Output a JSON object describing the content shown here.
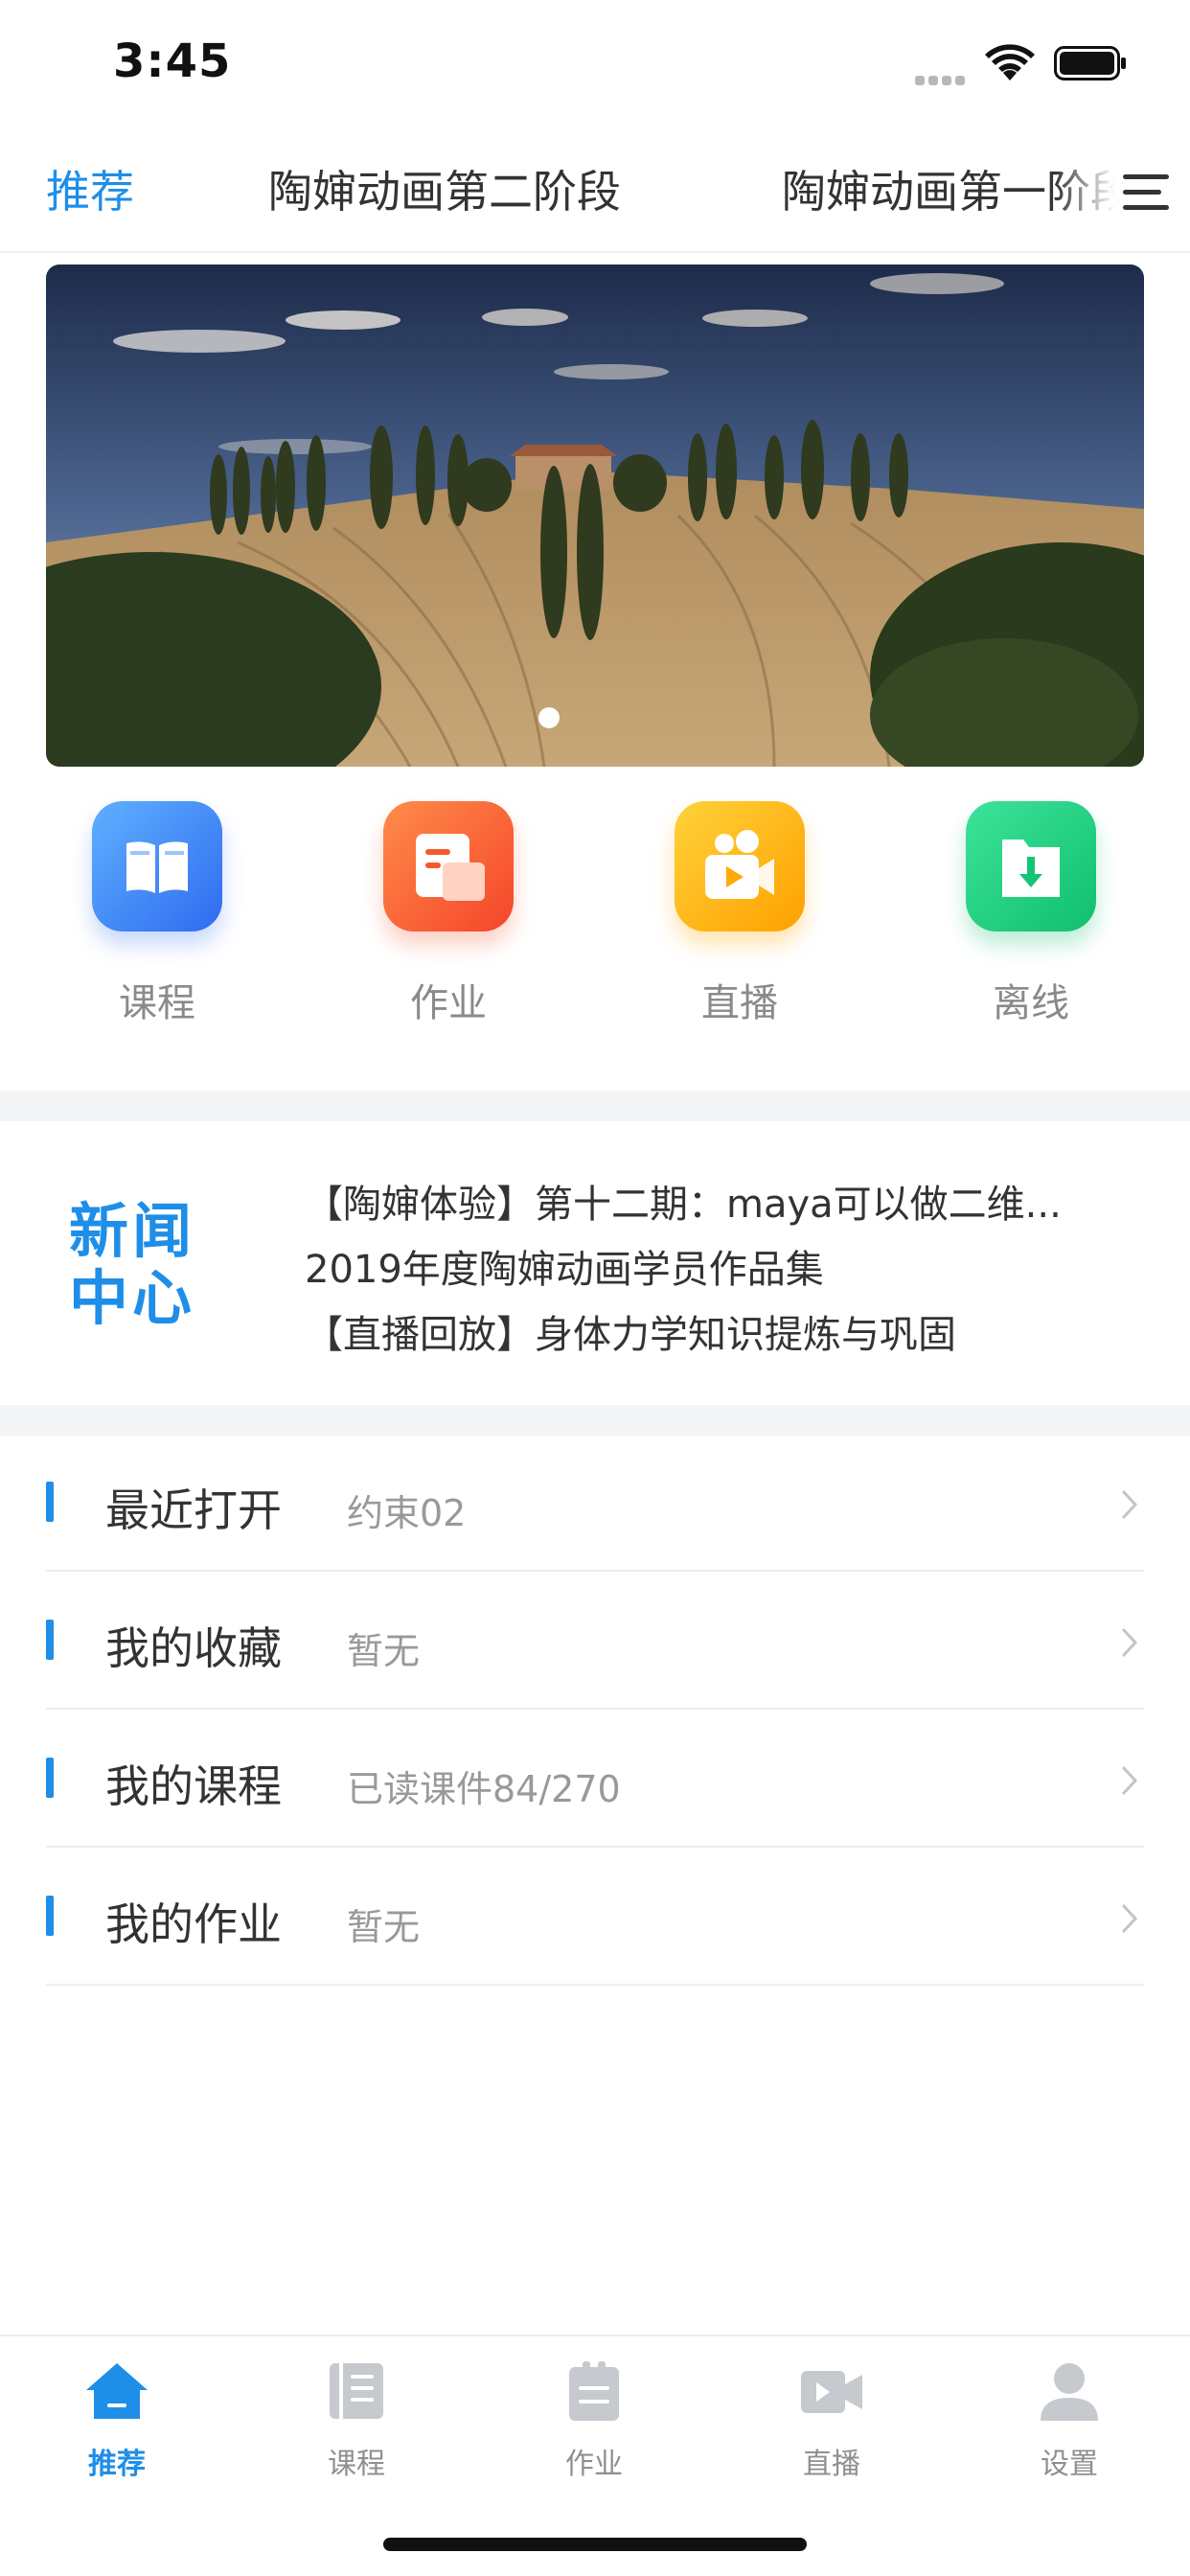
{
  "status_bar": {
    "time": "3:45"
  },
  "top_tabs": {
    "items": [
      {
        "label": "推荐",
        "active": true
      },
      {
        "label": "陶婶动画第二阶段",
        "active": false
      },
      {
        "label": "陶婶动画第一阶段",
        "active": false
      }
    ]
  },
  "banner": {
    "page_count": 1,
    "current_page": 1
  },
  "shortcuts": [
    {
      "label": "课程",
      "icon": "book-icon",
      "color": "#3d8bff"
    },
    {
      "label": "作业",
      "icon": "document-icon",
      "color": "#ff6a3d"
    },
    {
      "label": "直播",
      "icon": "video-camera-icon",
      "color": "#ffb300"
    },
    {
      "label": "离线",
      "icon": "download-icon",
      "color": "#1fcf7c"
    }
  ],
  "news": {
    "logo_line1": "新闻",
    "logo_line2": "中心",
    "items": [
      "【陶婶体验】第十二期：maya可以做二维...",
      "2019年度陶婶动画学员作品集",
      "【直播回放】身体力学知识提炼与巩固"
    ]
  },
  "list": [
    {
      "title": "最近打开",
      "subtitle": "约束02"
    },
    {
      "title": "我的收藏",
      "subtitle": "暂无"
    },
    {
      "title": "我的课程",
      "subtitle": "已读课件84/270"
    },
    {
      "title": "我的作业",
      "subtitle": "暂无"
    }
  ],
  "bottom_tabs": [
    {
      "label": "推荐",
      "icon": "home-icon",
      "active": true
    },
    {
      "label": "课程",
      "icon": "book-icon",
      "active": false
    },
    {
      "label": "作业",
      "icon": "clipboard-icon",
      "active": false
    },
    {
      "label": "直播",
      "icon": "video-camera-icon",
      "active": false
    },
    {
      "label": "设置",
      "icon": "user-icon",
      "active": false
    }
  ],
  "colors": {
    "accent": "#1f8ee8",
    "text_primary": "#333333",
    "text_secondary": "#999999",
    "divider": "#f4f5f7"
  }
}
